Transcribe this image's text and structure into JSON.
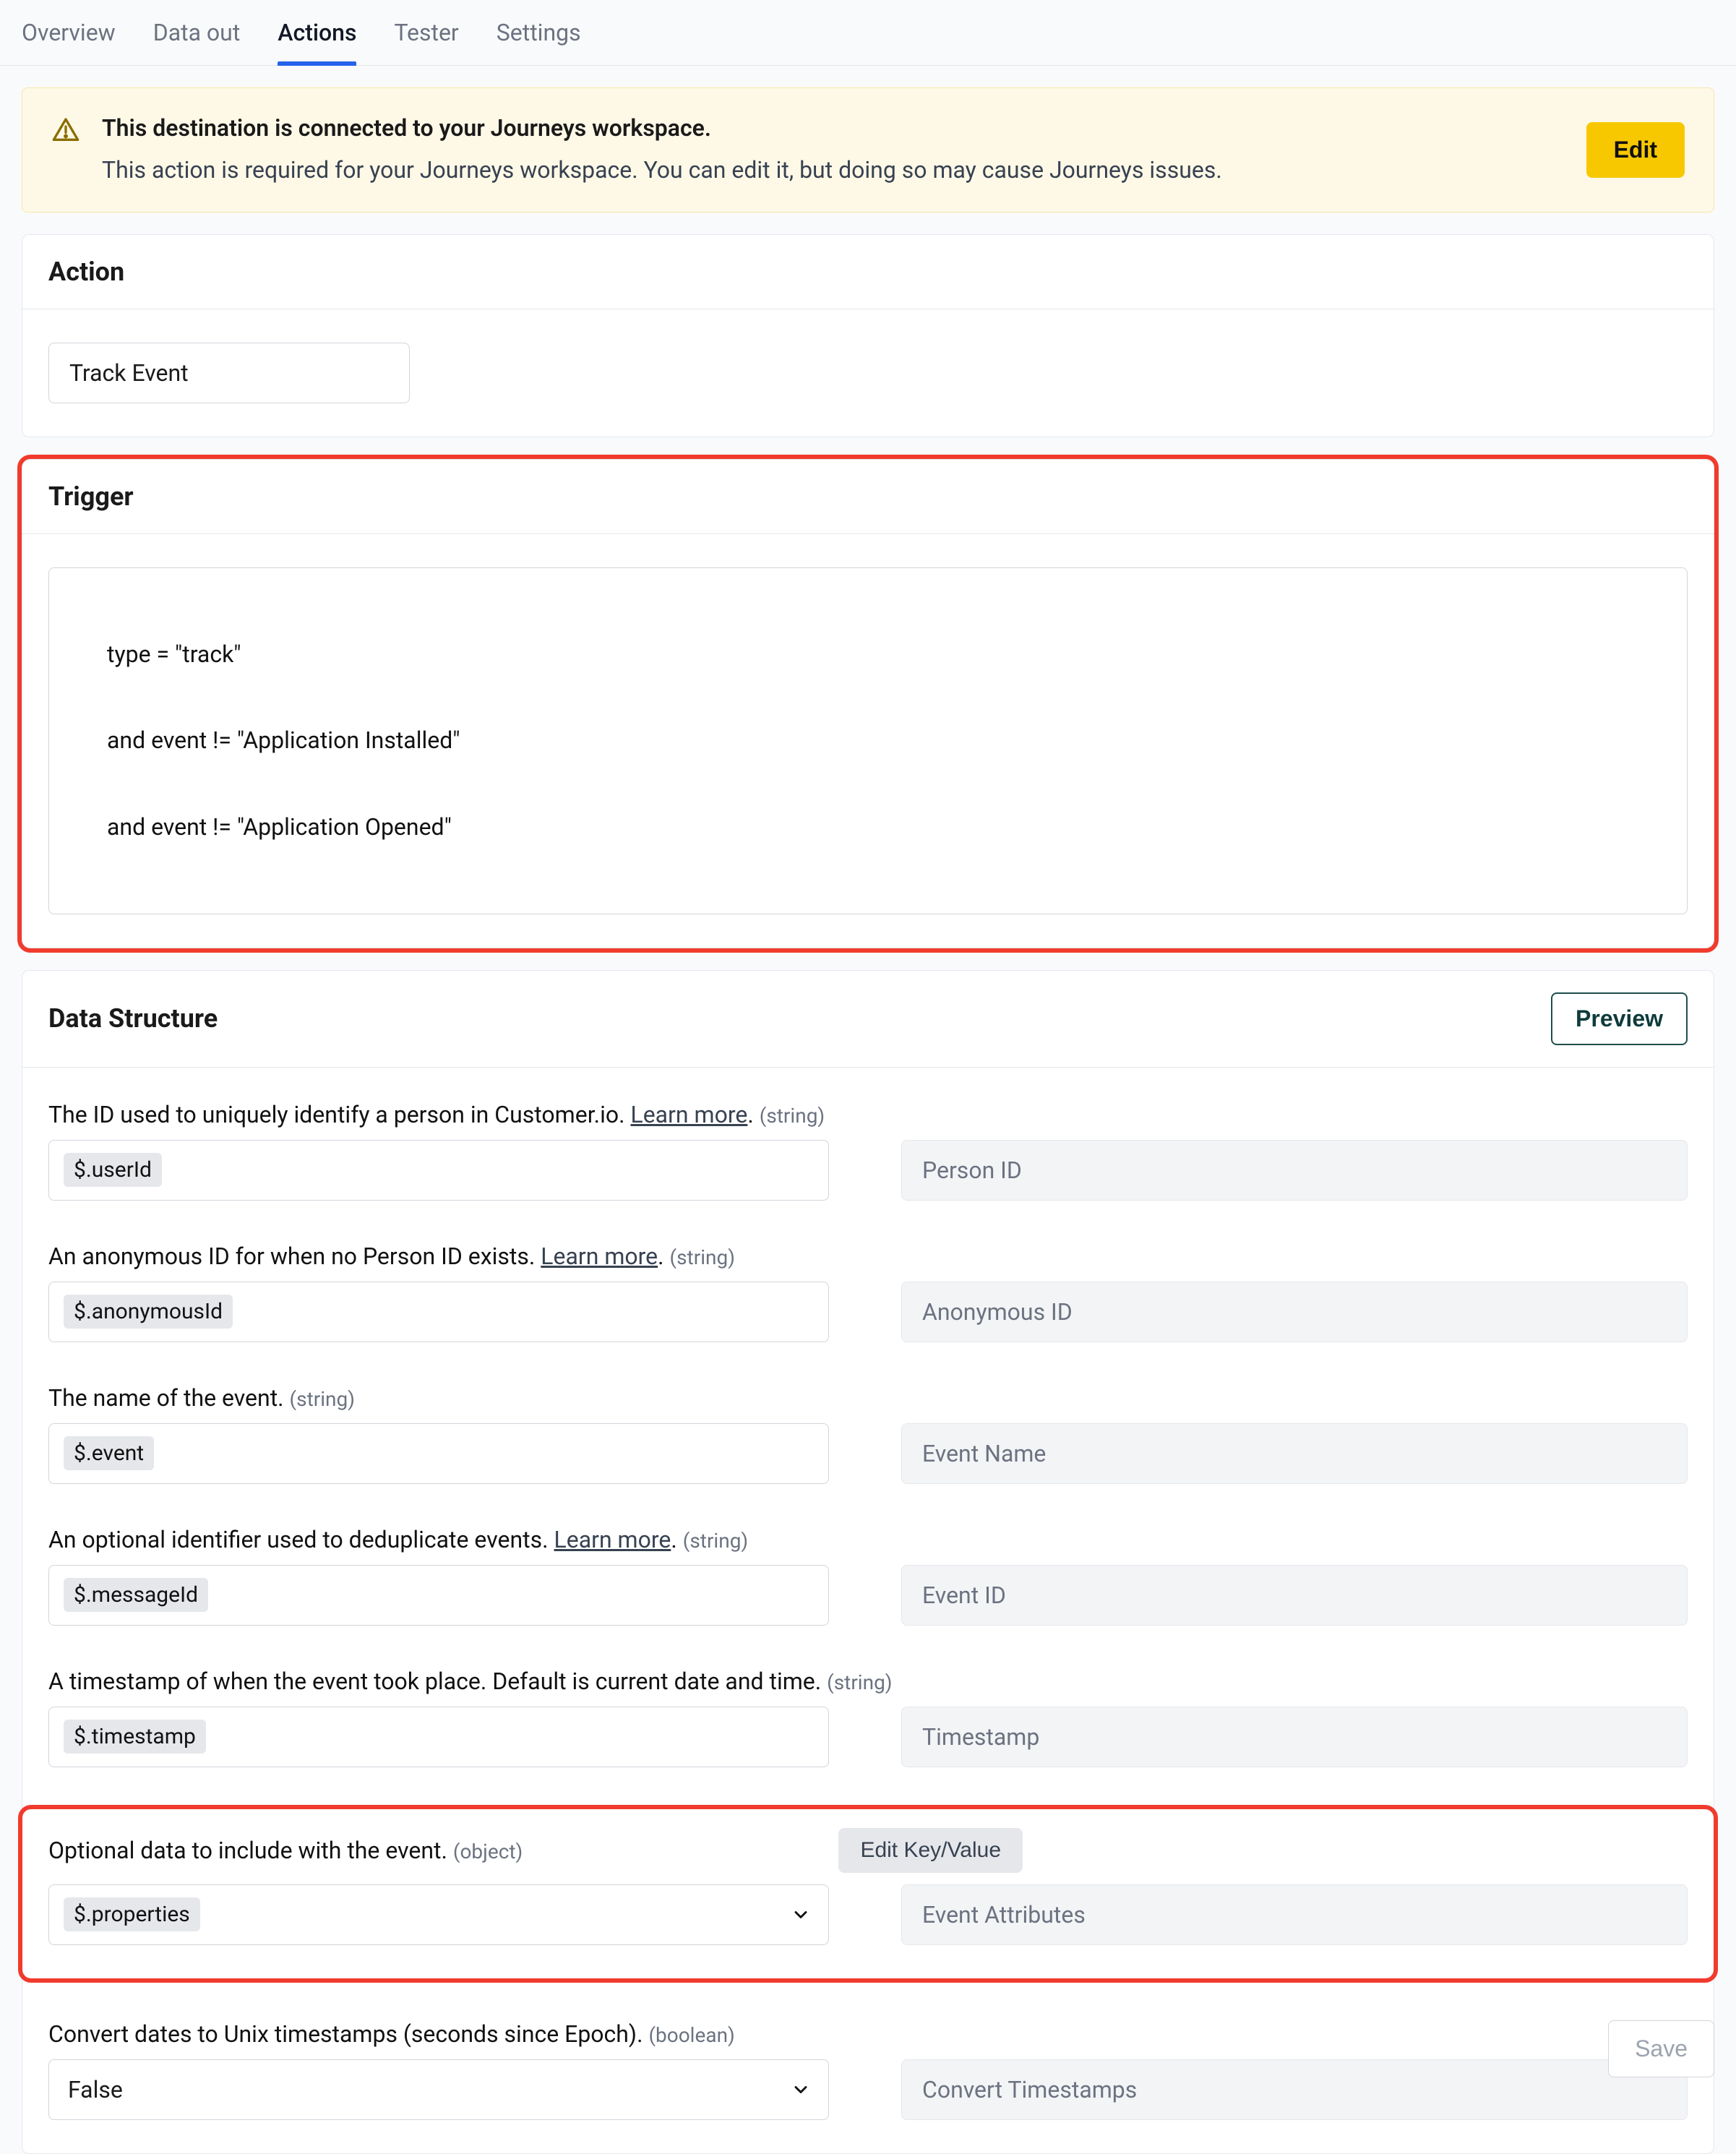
{
  "tabs": [
    "Overview",
    "Data out",
    "Actions",
    "Tester",
    "Settings"
  ],
  "activeTab": "Actions",
  "alert": {
    "title": "This destination is connected to your Journeys workspace.",
    "desc": "This action is required for your Journeys workspace. You can edit it, but doing so may cause Journeys issues.",
    "button": "Edit"
  },
  "action": {
    "title": "Action",
    "value": "Track Event"
  },
  "trigger": {
    "title": "Trigger",
    "lines": [
      "type = \"track\"",
      "and event != \"Application Installed\"",
      "and event != \"Application Opened\""
    ]
  },
  "dataStruct": {
    "title": "Data Structure",
    "preview": "Preview"
  },
  "fields": {
    "personId": {
      "desc": "The ID used to uniquely identify a person in Customer.io. ",
      "learn": "Learn more",
      "type": "(string)",
      "token": "$.userId",
      "placeholder": "Person ID"
    },
    "anonId": {
      "desc": "An anonymous ID for when no Person ID exists. ",
      "learn": "Learn more",
      "type": "(string)",
      "token": "$.anonymousId",
      "placeholder": "Anonymous ID"
    },
    "eventName": {
      "desc": "The name of the event. ",
      "type": "(string)",
      "token": "$.event",
      "placeholder": "Event Name"
    },
    "eventId": {
      "desc": "An optional identifier used to deduplicate events. ",
      "learn": "Learn more",
      "type": "(string)",
      "token": "$.messageId",
      "placeholder": "Event ID"
    },
    "timestamp": {
      "desc": "A timestamp of when the event took place. Default is current date and time. ",
      "type": "(string)",
      "token": "$.timestamp",
      "placeholder": "Timestamp"
    },
    "eventAttr": {
      "desc": "Optional data to include with the event. ",
      "type": "(object)",
      "kvBtn": "Edit Key/Value",
      "token": "$.properties",
      "placeholder": "Event Attributes"
    },
    "convertTs": {
      "desc": "Convert dates to Unix timestamps (seconds since Epoch). ",
      "type": "(boolean)",
      "value": "False",
      "placeholder": "Convert Timestamps"
    }
  },
  "save": "Save"
}
